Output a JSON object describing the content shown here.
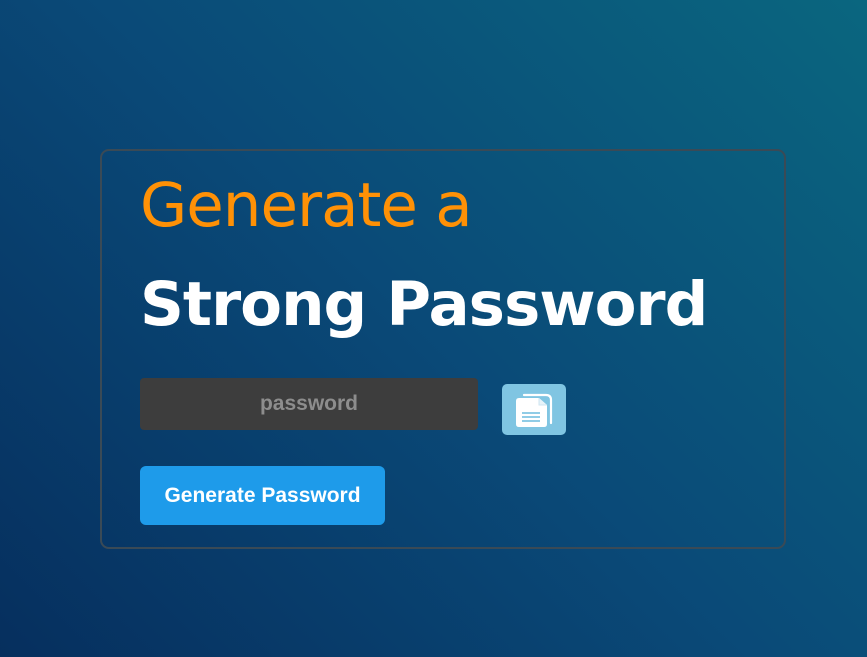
{
  "heading": {
    "line1": "Generate a",
    "line2": "Strong Password"
  },
  "password_field": {
    "value": "",
    "placeholder": "password"
  },
  "copy_button": {
    "icon": "copy-icon"
  },
  "generate_button": {
    "label": "Generate Password"
  },
  "colors": {
    "accent_orange": "#ff9106",
    "button_blue": "#1e9bea",
    "copy_button_bg": "#80c5e2",
    "input_bg": "#3d3d3d"
  }
}
